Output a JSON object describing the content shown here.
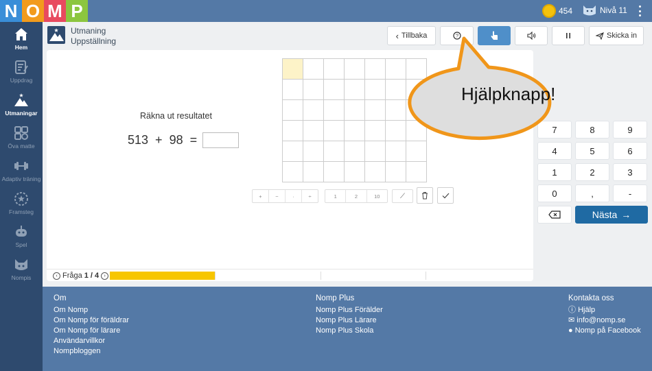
{
  "logo": {
    "letters": [
      "N",
      "O",
      "M",
      "P"
    ],
    "colors": [
      "#3a8ed8",
      "#f29b1d",
      "#e84a5f",
      "#8cc63f"
    ]
  },
  "topbar": {
    "coins": "454",
    "level": "Nivå 11"
  },
  "sidebar": {
    "items": [
      {
        "label": "Hem",
        "icon": "home-icon"
      },
      {
        "label": "Uppdrag",
        "icon": "clipboard-icon"
      },
      {
        "label": "Utmaningar",
        "icon": "mountain-icon"
      },
      {
        "label": "Öva matte",
        "icon": "calculator-icon"
      },
      {
        "label": "Adaptiv träning",
        "icon": "dumbbell-icon"
      },
      {
        "label": "Framsteg",
        "icon": "progress-icon"
      },
      {
        "label": "Spel",
        "icon": "gamepad-icon"
      },
      {
        "label": "Nompis",
        "icon": "cat-icon"
      }
    ]
  },
  "header": {
    "title_line1": "Utmaning",
    "title_line2": "Uppställning",
    "buttons": {
      "back": "Tillbaka",
      "help": "help-icon",
      "pointer": "pointer-icon",
      "sound": "speaker-icon",
      "pause": "pause-icon",
      "submit": "Skicka in"
    }
  },
  "task": {
    "instruction": "Räkna ut resultatet",
    "left": "513",
    "op": "+",
    "right": "98",
    "eq": "=",
    "answer": ""
  },
  "tools": {
    "ops": [
      "+",
      "−",
      "·",
      "÷"
    ],
    "nums": [
      "1",
      "2",
      "10"
    ]
  },
  "progress": {
    "prefix": "Fråga",
    "current": "1 / 4",
    "fraction": 0.25
  },
  "keypad": {
    "rows": [
      [
        "7",
        "8",
        "9"
      ],
      [
        "4",
        "5",
        "6"
      ],
      [
        "1",
        "2",
        "3"
      ],
      [
        "0",
        ",",
        "-"
      ]
    ],
    "next": "Nästa"
  },
  "callout": {
    "text": "Hjälpknapp!"
  },
  "footer": {
    "col1": {
      "heading": "Om",
      "links": [
        "Om Nomp",
        "Om Nomp för föräldrar",
        "Om Nomp för lärare",
        "Användarvillkor",
        "Nompbloggen"
      ]
    },
    "col2": {
      "heading": "Nomp Plus",
      "links": [
        "Nomp Plus Förälder",
        "Nomp Plus Lärare",
        "Nomp Plus Skola"
      ]
    },
    "col3": {
      "heading": "Kontakta oss",
      "links": [
        "Hjälp",
        "info@nomp.se",
        "Nomp på Facebook"
      ]
    }
  }
}
